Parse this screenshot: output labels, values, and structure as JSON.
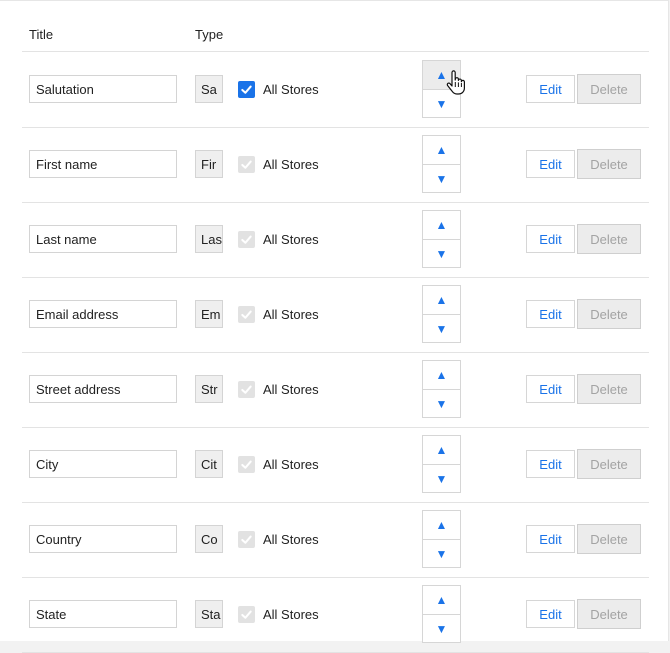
{
  "header": {
    "title_col": "Title",
    "type_col": "Type"
  },
  "rows": [
    {
      "title": "Salutation",
      "type": "Sa",
      "all_stores_checked": true,
      "all_stores_disabled": false,
      "all_stores_label": "All Stores",
      "edit_label": "Edit",
      "delete_label": "Delete",
      "up_hover": true
    },
    {
      "title": "First name",
      "type": "Fir",
      "all_stores_checked": true,
      "all_stores_disabled": true,
      "all_stores_label": "All Stores",
      "edit_label": "Edit",
      "delete_label": "Delete",
      "up_hover": false
    },
    {
      "title": "Last name",
      "type": "Las",
      "all_stores_checked": true,
      "all_stores_disabled": true,
      "all_stores_label": "All Stores",
      "edit_label": "Edit",
      "delete_label": "Delete",
      "up_hover": false
    },
    {
      "title": "Email address",
      "type": "Em",
      "all_stores_checked": true,
      "all_stores_disabled": true,
      "all_stores_label": "All Stores",
      "edit_label": "Edit",
      "delete_label": "Delete",
      "up_hover": false
    },
    {
      "title": "Street address",
      "type": "Str",
      "all_stores_checked": true,
      "all_stores_disabled": true,
      "all_stores_label": "All Stores",
      "edit_label": "Edit",
      "delete_label": "Delete",
      "up_hover": false
    },
    {
      "title": "City",
      "type": "Cit",
      "all_stores_checked": true,
      "all_stores_disabled": true,
      "all_stores_label": "All Stores",
      "edit_label": "Edit",
      "delete_label": "Delete",
      "up_hover": false
    },
    {
      "title": "Country",
      "type": "Co",
      "all_stores_checked": true,
      "all_stores_disabled": true,
      "all_stores_label": "All Stores",
      "edit_label": "Edit",
      "delete_label": "Delete",
      "up_hover": false
    },
    {
      "title": "State",
      "type": "Sta",
      "all_stores_checked": true,
      "all_stores_disabled": true,
      "all_stores_label": "All Stores",
      "edit_label": "Edit",
      "delete_label": "Delete",
      "up_hover": false
    }
  ],
  "icons": {
    "up": "up-arrow-icon",
    "down": "down-arrow-icon",
    "check": "checkmark-icon",
    "cursor": "hand-pointer-icon"
  },
  "colors": {
    "accent": "#1a73e8",
    "disabled_text": "#a3a3a3",
    "border": "#d6d6d6"
  }
}
